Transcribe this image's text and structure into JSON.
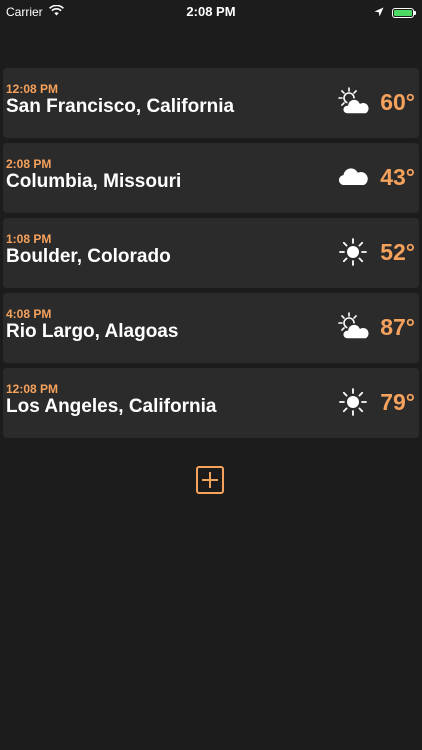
{
  "status_bar": {
    "carrier": "Carrier",
    "time": "2:08 PM",
    "battery_color": "#4cd964"
  },
  "colors": {
    "accent": "#f5a25d",
    "background": "#1c1c1c",
    "card": "#2c2b2b"
  },
  "cities": [
    {
      "time": "12:08 PM",
      "name": "San Francisco, California",
      "temp": "60°",
      "icon": "partly-cloudy-icon"
    },
    {
      "time": "2:08 PM",
      "name": "Columbia, Missouri",
      "temp": "43°",
      "icon": "cloud-icon"
    },
    {
      "time": "1:08 PM",
      "name": "Boulder, Colorado",
      "temp": "52°",
      "icon": "sun-icon"
    },
    {
      "time": "4:08 PM",
      "name": "Rio Largo, Alagoas",
      "temp": "87°",
      "icon": "partly-cloudy-icon"
    },
    {
      "time": "12:08 PM",
      "name": "Los Angeles, California",
      "temp": "79°",
      "icon": "sun-icon"
    }
  ],
  "add_button": {
    "icon": "plus-icon"
  }
}
